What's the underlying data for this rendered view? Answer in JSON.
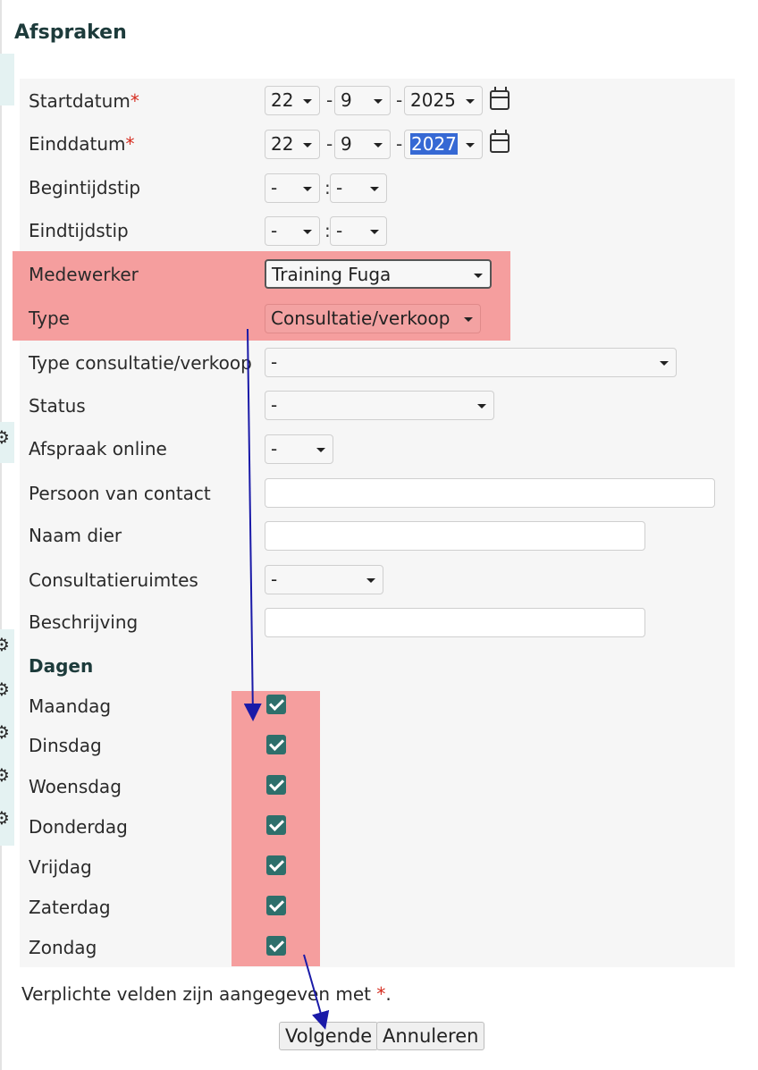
{
  "page": {
    "title": "Afspraken"
  },
  "form": {
    "required_mark": "*",
    "startdatum": {
      "label": "Startdatum",
      "day": "22",
      "month": "9",
      "year": "2025",
      "sep": "-"
    },
    "einddatum": {
      "label": "Einddatum",
      "day": "22",
      "month": "9",
      "year": "2027",
      "sep": "-"
    },
    "begintijdstip": {
      "label": "Begintijdstip",
      "hour": "-",
      "minute": "-",
      "sep": ":"
    },
    "eindtijdstip": {
      "label": "Eindtijdstip",
      "hour": "-",
      "minute": "-",
      "sep": ":"
    },
    "medewerker": {
      "label": "Medewerker",
      "value": "Training Fuga"
    },
    "type": {
      "label": "Type",
      "value": "Consultatie/verkoop"
    },
    "type_consultatie": {
      "label": "Type consultatie/verkoop",
      "value": "-"
    },
    "status": {
      "label": "Status",
      "value": "-"
    },
    "afspraak_online": {
      "label": "Afspraak online",
      "value": "-"
    },
    "persoon_van_contact": {
      "label": "Persoon van contact",
      "value": ""
    },
    "naam_dier": {
      "label": "Naam dier",
      "value": ""
    },
    "consultatieruimtes": {
      "label": "Consultatieruimtes",
      "value": "-"
    },
    "beschrijving": {
      "label": "Beschrijving",
      "value": ""
    }
  },
  "dagen": {
    "heading": "Dagen",
    "days": [
      {
        "label": "Maandag",
        "checked": true
      },
      {
        "label": "Dinsdag",
        "checked": true
      },
      {
        "label": "Woensdag",
        "checked": true
      },
      {
        "label": "Donderdag",
        "checked": true
      },
      {
        "label": "Vrijdag",
        "checked": true
      },
      {
        "label": "Zaterdag",
        "checked": true
      },
      {
        "label": "Zondag",
        "checked": true
      }
    ]
  },
  "footer": {
    "note_text": "Verplichte velden zijn aangegeven met ",
    "note_mark": "*",
    "note_end": ".",
    "next_button": "Volgende",
    "cancel_button": "Annuleren"
  },
  "colors": {
    "accent": "#2e6f6b",
    "highlight_overlay": "#f49999",
    "annotation_arrow": "#1a1aa8",
    "required": "#d52b1e"
  },
  "icons": [
    "calendar-icon",
    "gear-icon",
    "check-icon"
  ]
}
